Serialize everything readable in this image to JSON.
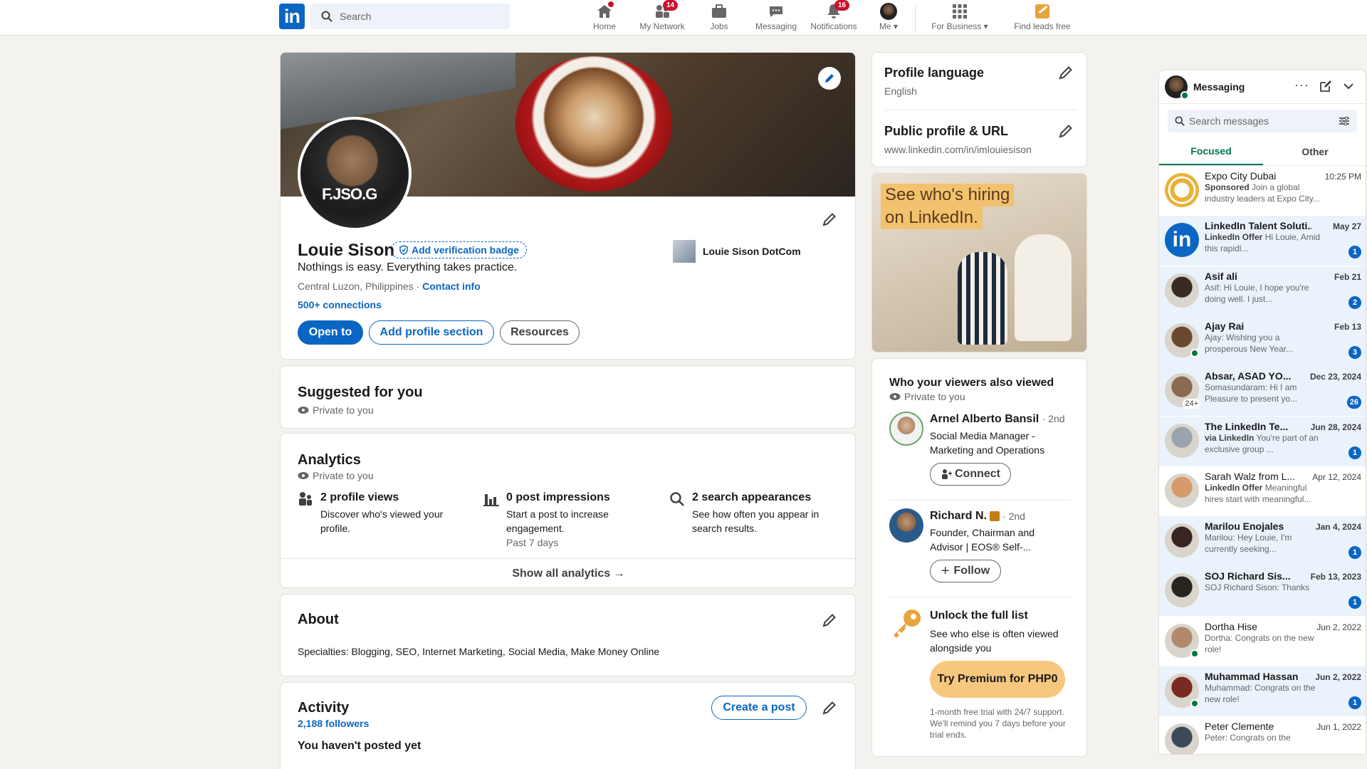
{
  "nav": {
    "search_placeholder": "Search",
    "items": [
      {
        "label": "Home",
        "badge": ""
      },
      {
        "label": "My Network",
        "badge": "14"
      },
      {
        "label": "Jobs",
        "badge": ""
      },
      {
        "label": "Messaging",
        "badge": ""
      },
      {
        "label": "Notifications",
        "badge": "16"
      },
      {
        "label": "Me",
        "badge": ""
      },
      {
        "label": "For Business",
        "badge": ""
      },
      {
        "label": "Find leads free",
        "badge": ""
      }
    ],
    "logo": "in"
  },
  "profile": {
    "name": "Louie Sison",
    "verification": "Add verification badge",
    "headline": "Nothings is easy. Everything takes practice.",
    "location": "Central Luzon, Philippines",
    "sep": " · ",
    "contact": "Contact info",
    "connections": "500+ connections",
    "company": "Louie Sison DotCom",
    "btn_open": "Open to",
    "btn_add": "Add profile section",
    "btn_resources": "Resources",
    "avatar_text": "F.JSO.G"
  },
  "suggested": {
    "title": "Suggested for you",
    "private": "Private to you"
  },
  "analytics": {
    "title": "Analytics",
    "private": "Private to you",
    "items": [
      {
        "title": "2 profile views",
        "desc": "Discover who's viewed your profile.",
        "sub": ""
      },
      {
        "title": "0 post impressions",
        "desc": "Start a post to increase engagement.",
        "sub": "Past 7 days"
      },
      {
        "title": "2 search appearances",
        "desc": "See how often you appear in search results.",
        "sub": ""
      }
    ],
    "show_all": "Show all analytics →"
  },
  "about": {
    "title": "About",
    "text": "Specialties: Blogging, SEO, Internet Marketing, Social Media, Make Money Online"
  },
  "activity": {
    "title": "Activity",
    "followers": "2,188 followers",
    "create": "Create a post",
    "empty": "You haven't posted yet"
  },
  "side": {
    "lang_title": "Profile language",
    "lang_value": "English",
    "url_title": "Public profile & URL",
    "url_value": "www.linkedin.com/in/imlouiesison",
    "ad_line1": "See who's hiring",
    "ad_line2": "on LinkedIn."
  },
  "viewers": {
    "title": "Who your viewers also viewed",
    "private": "Private to you",
    "people": [
      {
        "name": "Arnel Alberto Bansil",
        "degree": "· 2nd",
        "headline": "Social Media Manager - Marketing and Operations",
        "action": "Connect"
      },
      {
        "name": "Richard N.",
        "degree": "· 2nd",
        "headline": "Founder, Chairman and Advisor | EOS® Self-...",
        "action": "Follow"
      }
    ],
    "unlock_title": "Unlock the full list",
    "unlock_desc": "See who else is often viewed alongside you",
    "premium_btn": "Try Premium for PHP0",
    "trial_text": "1-month free trial with 24/7 support. We'll remind you 7 days before your trial ends."
  },
  "messaging": {
    "title": "Messaging",
    "search_placeholder": "Search messages",
    "tab_focused": "Focused",
    "tab_other": "Other",
    "conversations": [
      {
        "name": "Expo City Dubai",
        "date": "10:25 PM",
        "tag": "Sponsored",
        "preview": "Join a global industry leaders at Expo City...",
        "count": "",
        "color": "#e8b23a"
      },
      {
        "name": "LinkedIn Talent Soluti...",
        "date": "May 27",
        "tag": "LinkedIn Offer",
        "preview": "Hi Louie, Amid this rapidl...",
        "count": "1",
        "color": "#0a66c2"
      },
      {
        "name": "Asif ali",
        "date": "Feb 21",
        "tag": "",
        "preview": "Asif: Hi Louie, I hope you're doing well. I just...",
        "count": "2",
        "color": "#3b2a22"
      },
      {
        "name": "Ajay Rai",
        "date": "Feb 13",
        "tag": "",
        "preview": "Ajay: Wishing you a prosperous New Year...",
        "count": "3",
        "color": "#6a4a2e"
      },
      {
        "name": "Absar, ASAD YO...",
        "date": "Dec 23, 2024",
        "tag": "",
        "preview": "Somasundaram: Hi I am Pleasure to present yo...",
        "count": "26",
        "color": "#8a6a50"
      },
      {
        "name": "The LinkedIn Te...",
        "date": "Jun 28, 2024",
        "tag": "via LinkedIn",
        "preview": "You're part of an exclusive group ...",
        "count": "1",
        "color": "#9aa4ad"
      },
      {
        "name": "Sarah Walz from L...",
        "date": "Apr 12, 2024",
        "tag": "LinkedIn Offer",
        "preview": "Meaningful hires start with meaningful...",
        "count": "",
        "color": "#d49a6a"
      },
      {
        "name": "Marilou Enojales",
        "date": "Jan 4, 2024",
        "tag": "",
        "preview": "Marilou: Hey Louie, I'm currently seeking...",
        "count": "1",
        "color": "#3a2620"
      },
      {
        "name": "SOJ Richard Sis...",
        "date": "Feb 13, 2023",
        "tag": "",
        "preview": "SOJ Richard Sison: Thanks",
        "count": "1",
        "color": "#2a2420"
      },
      {
        "name": "Dortha Hise",
        "date": "Jun 2, 2022",
        "tag": "",
        "preview": "Dortha: Congrats on the new role!",
        "count": "",
        "color": "#b08a6a"
      },
      {
        "name": "Muhammad Hassan",
        "date": "Jun 2, 2022",
        "tag": "",
        "preview": "Muhammad: Congrats on the new role!",
        "count": "1",
        "color": "#7a2a20"
      },
      {
        "name": "Peter Clemente",
        "date": "Jun 1, 2022",
        "tag": "",
        "preview": "Peter: Congrats on the",
        "count": "",
        "color": "#3a4a5a"
      }
    ],
    "group_more": "24+"
  },
  "colors": {
    "brand": "#0a66c2",
    "premium": "#f8c77e",
    "badge": "#cb112d",
    "online": "#057642"
  }
}
